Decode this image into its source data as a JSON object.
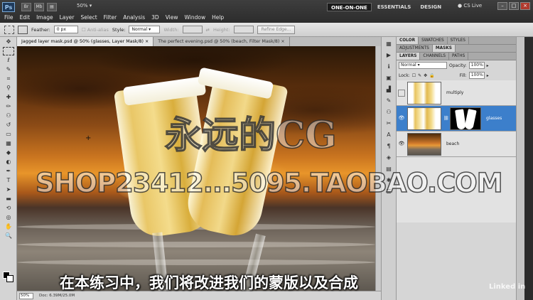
{
  "app": {
    "logo": "Ps",
    "zoom": "50%",
    "menu": [
      "File",
      "Edit",
      "Image",
      "Layer",
      "Select",
      "Filter",
      "Analysis",
      "3D",
      "View",
      "Window",
      "Help"
    ],
    "workspaces": [
      "ONE-ON-ONE",
      "ESSENTIALS",
      "DESIGN"
    ],
    "cs_live": "CS Live"
  },
  "options": {
    "feather_label": "Feather:",
    "feather_value": "0 px",
    "antialias_label": "Anti-alias",
    "style_label": "Style:",
    "style_value": "Normal",
    "width_label": "Width:",
    "height_label": "Height:",
    "refine_label": "Refine Edge..."
  },
  "document": {
    "tabs": [
      "Jagged layer mask.psd @ 50% (glasses, Layer Mask/8) ×",
      "The perfect evening.psd @ 50% (beach, Filter Mask/8) ×"
    ],
    "status_zoom": "50%",
    "status_doc": "Doc: 6.39M/25.0M"
  },
  "panels": {
    "top_tabs": [
      "COLOR",
      "SWATCHES",
      "STYLES"
    ],
    "mid_tabs": [
      "ADJUSTMENTS",
      "MASKS"
    ],
    "layer_tabs": [
      "LAYERS",
      "CHANNELS",
      "PATHS"
    ],
    "blend_mode": "Normal",
    "opacity_label": "Opacity:",
    "opacity_value": "100%",
    "lock_label": "Lock:",
    "fill_label": "Fill:",
    "fill_value": "100%",
    "layers": [
      {
        "name": "multiply",
        "visible": false,
        "selected": false
      },
      {
        "name": "glasses",
        "visible": true,
        "selected": true
      },
      {
        "name": "beach",
        "visible": true,
        "selected": false
      }
    ]
  },
  "overlay": {
    "watermark_cn": "永远的CG",
    "watermark_shop": "SHOP23412...5095.TAOBAO.COM",
    "subtitle": "在本练习中，我们将改进我们的蒙版以及合成",
    "brand": "Linked in"
  }
}
